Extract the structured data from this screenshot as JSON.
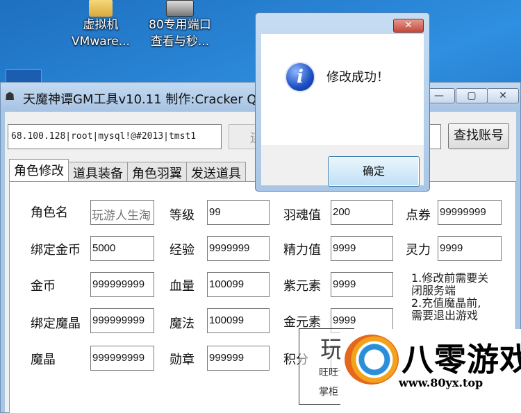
{
  "desktop": {
    "icons": [
      {
        "line1": "虚拟机",
        "line2": "VMware..."
      },
      {
        "line1": "80专用端口",
        "line2": "查看与秒..."
      }
    ]
  },
  "window": {
    "title": "天魔神谭GM工具v10.11  制作:Cracker  Q",
    "controls": {
      "minimize": "—",
      "maximize": "▢",
      "close": "✕"
    }
  },
  "toolbar": {
    "connection_value": "68.100.128|root|mysql!@#2013|tmst1",
    "connect_label": "连",
    "account_value": "",
    "find_label": "查找账号"
  },
  "tabs": [
    {
      "label": "角色修改",
      "active": true
    },
    {
      "label": "道具装备",
      "active": false
    },
    {
      "label": "角色羽翼",
      "active": false
    },
    {
      "label": "发送道具",
      "active": false
    }
  ],
  "form": {
    "role_name": {
      "label": "角色名",
      "value": "玩游人生淘"
    },
    "level": {
      "label": "等级",
      "value": "99"
    },
    "feather_soul": {
      "label": "羽魂值",
      "value": "200"
    },
    "points": {
      "label": "点券",
      "value": "99999999"
    },
    "bound_gold": {
      "label": "绑定金币",
      "value": "5000"
    },
    "exp": {
      "label": "经验",
      "value": "9999999"
    },
    "energy": {
      "label": "精力值",
      "value": "9999"
    },
    "spirit": {
      "label": "灵力",
      "value": "9999"
    },
    "gold": {
      "label": "金币",
      "value": "999999999"
    },
    "hp": {
      "label": "血量",
      "value": "100099"
    },
    "purple": {
      "label": "紫元素",
      "value": "9999"
    },
    "bound_crystal": {
      "label": "绑定魔晶",
      "value": "999999999"
    },
    "mp": {
      "label": "魔法",
      "value": "100099"
    },
    "gold_elem": {
      "label": "金元素",
      "value": "9999"
    },
    "crystal": {
      "label": "魔晶",
      "value": "999999999"
    },
    "medal": {
      "label": "勋章",
      "value": "999999"
    },
    "score": {
      "label": "积分",
      "value": ""
    }
  },
  "notes": {
    "line1": "1.修改前需要关",
    "line2": "闭服务端",
    "line3": "2.充值魔晶前,",
    "line4": "需要退出游戏"
  },
  "dialog": {
    "message": "修改成功！",
    "ok_label": "确定",
    "close_label": "✕"
  },
  "watermark": {
    "big": "玩",
    "small1": "旺旺",
    "small2": "掌柜"
  },
  "logo": {
    "name": "八零游戏",
    "url": "www.80yx.top"
  }
}
